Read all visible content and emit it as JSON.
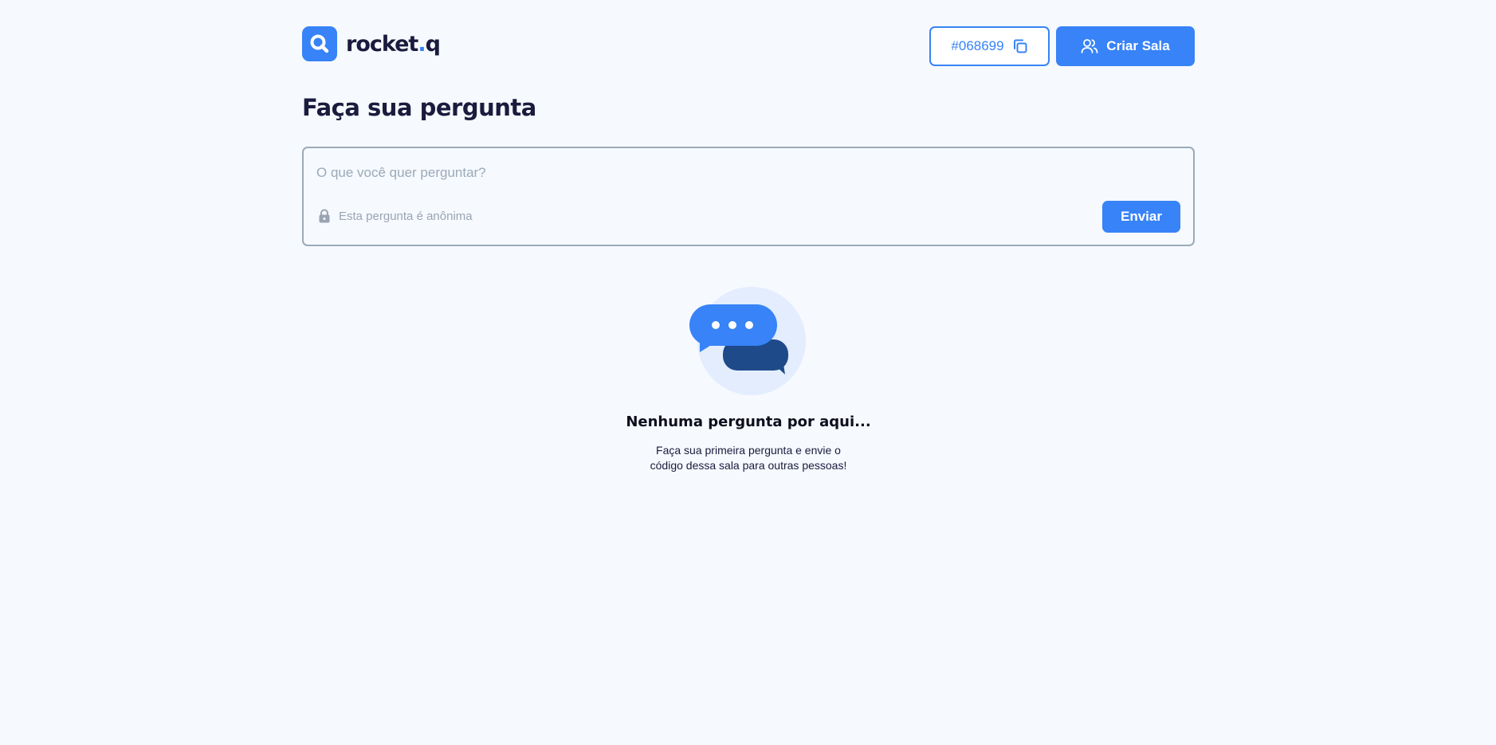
{
  "header": {
    "logo_text": "rocket",
    "logo_dot": ".",
    "logo_suffix": "q",
    "room_code": "#068699",
    "create_room_label": "Criar Sala"
  },
  "main": {
    "title": "Faça sua pergunta",
    "question_placeholder": "O que você quer perguntar?",
    "anonymous_label": "Esta pergunta é anônima",
    "send_label": "Enviar"
  },
  "empty_state": {
    "title": "Nenhuma pergunta por aqui...",
    "line1": "Faça sua primeira pergunta e envie o",
    "line2": "código dessa sala para outras pessoas!"
  },
  "icons": {
    "logo": "search-icon",
    "copy": "copy-icon",
    "users": "users-icon",
    "lock": "lock-icon",
    "illustration": "chat-bubbles-icon"
  },
  "colors": {
    "primary": "#3783f7",
    "dark": "#1a1b3d",
    "background": "#f6f9fe",
    "border": "#9aaab8",
    "bubble_dark": "#1e4a8a",
    "circle": "#e3edfd"
  }
}
